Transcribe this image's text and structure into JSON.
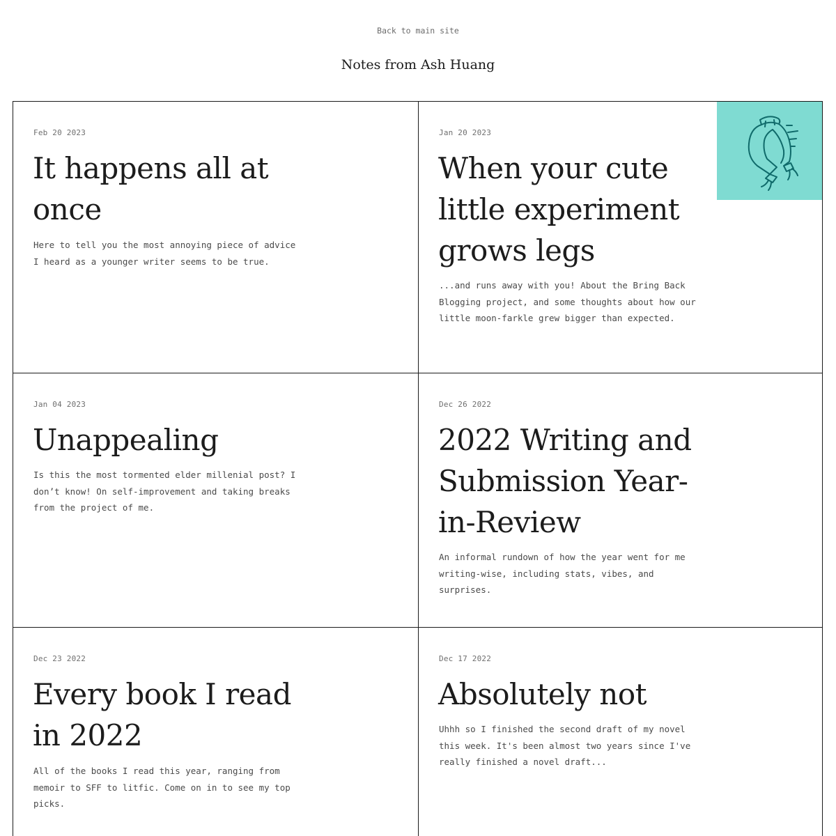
{
  "header": {
    "back_link": "Back to main site",
    "site_title": "Notes from Ash Huang"
  },
  "posts": [
    {
      "date": "Feb 20 2023",
      "title": "It happens all at once",
      "excerpt": "Here to tell you the most annoying piece of advice I heard as a younger writer seems to be true."
    },
    {
      "date": "Jan 20 2023",
      "title": "When your cute little experiment grows legs",
      "excerpt": "...and runs away with you! About the Bring Back Blogging project, and some thoughts about how our little moon-farkle grew bigger than expected.",
      "thumbnail_icon": "running-pants-illustration",
      "thumbnail_color": "#7fdbd2"
    },
    {
      "date": "Jan 04 2023",
      "title": "Unappealing",
      "excerpt": "Is this the most tormented elder millenial post? I don’t know! On self-improvement and taking breaks from the project of me."
    },
    {
      "date": "Dec 26 2022",
      "title": "2022 Writing and Submission Year-in-Review",
      "excerpt": "An informal rundown of how the year went for me writing-wise, including stats, vibes, and surprises."
    },
    {
      "date": "Dec 23 2022",
      "title": "Every book I read in 2022",
      "excerpt": "All of the books I read this year, ranging from memoir to SFF to litfic. Come on in to see my top picks."
    },
    {
      "date": "Dec 17 2022",
      "title": "Absolutely not",
      "excerpt": "Uhhh so I finished the second draft of my novel this week. It's been almost two years since I've really finished a novel draft..."
    }
  ]
}
